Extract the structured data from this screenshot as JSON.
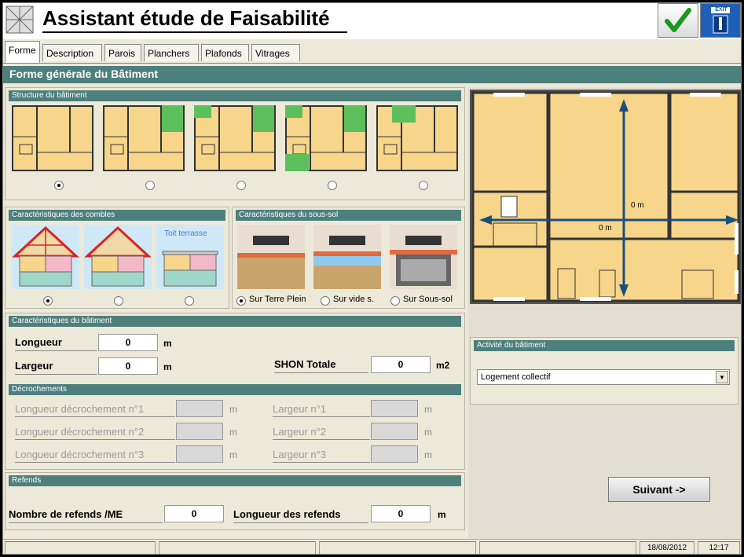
{
  "app": {
    "title": "Assistant étude de Faisabilité"
  },
  "toolbar": {
    "validate_icon": "check-icon",
    "exit_label": "EXIT"
  },
  "tabs": [
    {
      "label": "Forme",
      "active": true
    },
    {
      "label": "Description"
    },
    {
      "label": "Parois"
    },
    {
      "label": "Planchers"
    },
    {
      "label": "Plafonds"
    },
    {
      "label": "Vitrages"
    }
  ],
  "section_title": "Forme générale du Bâtiment",
  "structure": {
    "title": "Structure du bâtiment",
    "selected": 0
  },
  "combles": {
    "title": "Caractéristiques des combles",
    "toit_terrasse": "Toit terrasse",
    "selected": 0
  },
  "soussol": {
    "title": "Caractéristiques du sous-sol",
    "options": [
      "Sur Terre Plein",
      "Sur vide s.",
      "Sur Sous-sol"
    ],
    "selected": 0
  },
  "caracteristiques": {
    "title": "Caractéristiques du bâtiment",
    "longueur_label": "Longueur",
    "longueur_value": "0",
    "longueur_unit": "m",
    "largeur_label": "Largeur",
    "largeur_value": "0",
    "largeur_unit": "m",
    "shon_label": "SHON Totale",
    "shon_value": "0",
    "shon_unit": "m2"
  },
  "decrochements": {
    "title": "Décrochements",
    "rows": [
      {
        "longueur_label": "Longueur décrochement n°1",
        "largeur_label": "Largeur n°1"
      },
      {
        "longueur_label": "Longueur décrochement n°2",
        "largeur_label": "Largeur n°2"
      },
      {
        "longueur_label": "Longueur décrochement n°3",
        "largeur_label": "Largeur n°3"
      }
    ],
    "unit": "m"
  },
  "refends": {
    "title": "Refends",
    "nombre_label": "Nombre de refends /ME",
    "nombre_value": "0",
    "longueur_label": "Longueur des refends",
    "longueur_value": "0",
    "unit": "m"
  },
  "plan": {
    "vertical_dim": "0 m",
    "horizontal_dim": "0 m"
  },
  "activite": {
    "title": "Activité du bâtiment",
    "selected": "Logement collectif"
  },
  "buttons": {
    "next": "Suivant ->"
  },
  "status": {
    "date": "18/08/2012",
    "time": "12:17"
  },
  "colors": {
    "teal": "#4d7f7d",
    "plan_fill": "#f7d58a"
  }
}
